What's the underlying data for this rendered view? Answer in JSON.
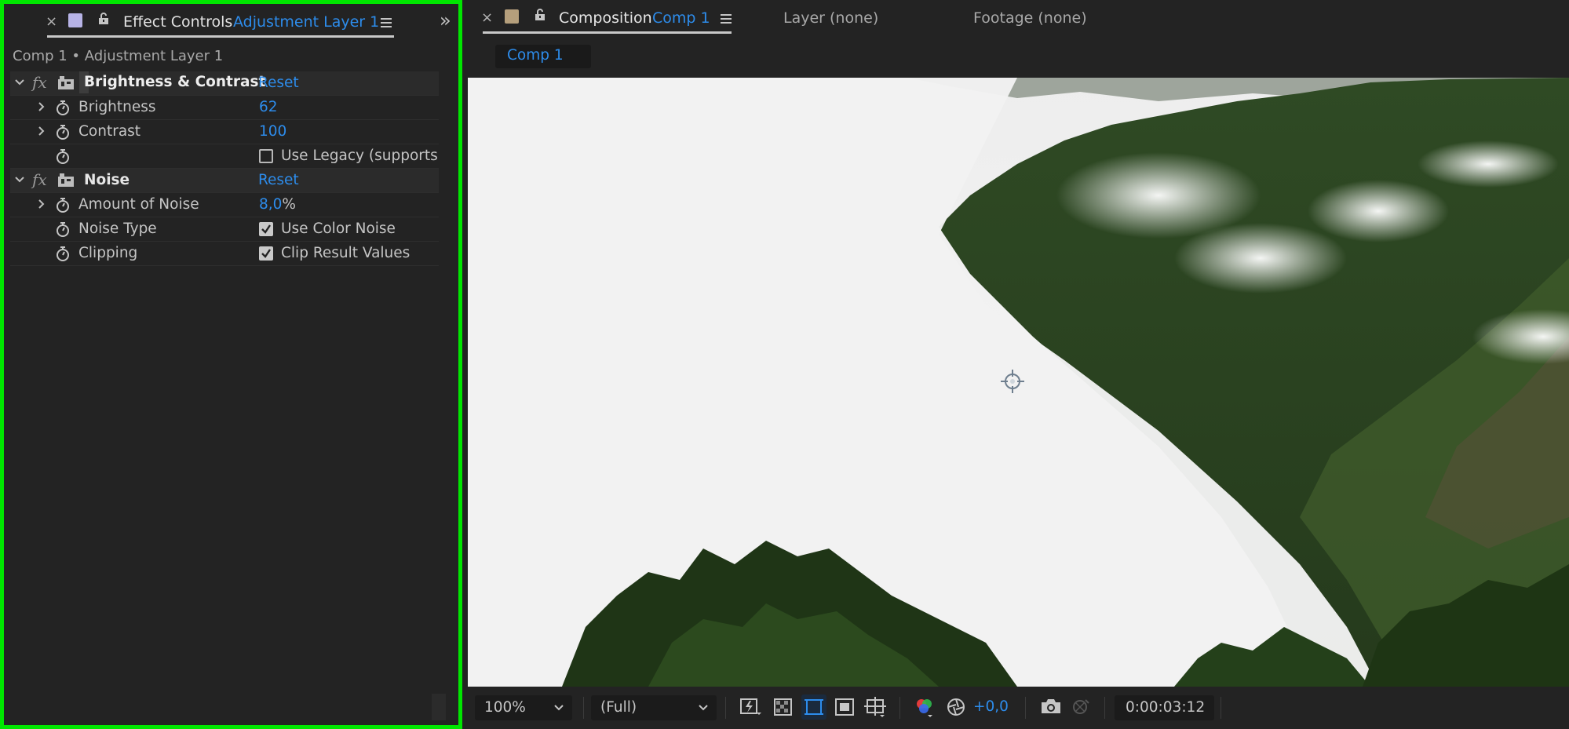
{
  "effect_controls": {
    "tab_label": "Effect Controls",
    "tab_layer": "Adjustment Layer 1",
    "close_glyph": "×",
    "expand_glyph": "»",
    "breadcrumb": "Comp 1 • Adjustment Layer 1",
    "swatch_color": "#b7b3e6",
    "effects": [
      {
        "name": "Brightness & Contrast",
        "reset_label": "Reset",
        "properties": [
          {
            "label": "Brightness",
            "value": "62"
          },
          {
            "label": "Contrast",
            "value": "100"
          },
          {
            "label": "",
            "checkbox_label": "Use Legacy (supports",
            "checked": false
          }
        ]
      },
      {
        "name": "Noise",
        "reset_label": "Reset",
        "properties": [
          {
            "label": "Amount of Noise",
            "value": "8,0",
            "unit": "%"
          },
          {
            "label": "Noise Type",
            "checkbox_label": "Use Color Noise",
            "checked": true
          },
          {
            "label": "Clipping",
            "checkbox_label": "Clip Result Values",
            "checked": true
          }
        ]
      }
    ]
  },
  "composition": {
    "close_glyph": "×",
    "tab_label": "Composition",
    "tab_comp": "Comp 1",
    "swatch_color": "#b59f7c",
    "layer_tab": "Layer (none)",
    "footage_tab": "Footage (none)",
    "subtab": "Comp 1"
  },
  "viewer_bar": {
    "zoom": "100%",
    "resolution": "(Full)",
    "exposure": "+0,0",
    "timecode": "0:00:03:12"
  },
  "colors": {
    "highlight_border": "#00e600",
    "accent_blue": "#2d8ceb"
  },
  "icons": [
    "close-icon",
    "lock-icon",
    "panel-menu-icon",
    "expand-panels-icon",
    "chevron-down-icon",
    "chevron-right-icon",
    "stopwatch-icon",
    "fx-icon",
    "layer-icon",
    "checkbox",
    "anchor-point-icon",
    "fast-previews-icon",
    "transparency-grid-icon",
    "mask-visibility-icon",
    "region-of-interest-icon",
    "guides-icon",
    "color-channels-icon",
    "exposure-reset-icon",
    "snapshot-icon",
    "show-snapshot-icon"
  ]
}
